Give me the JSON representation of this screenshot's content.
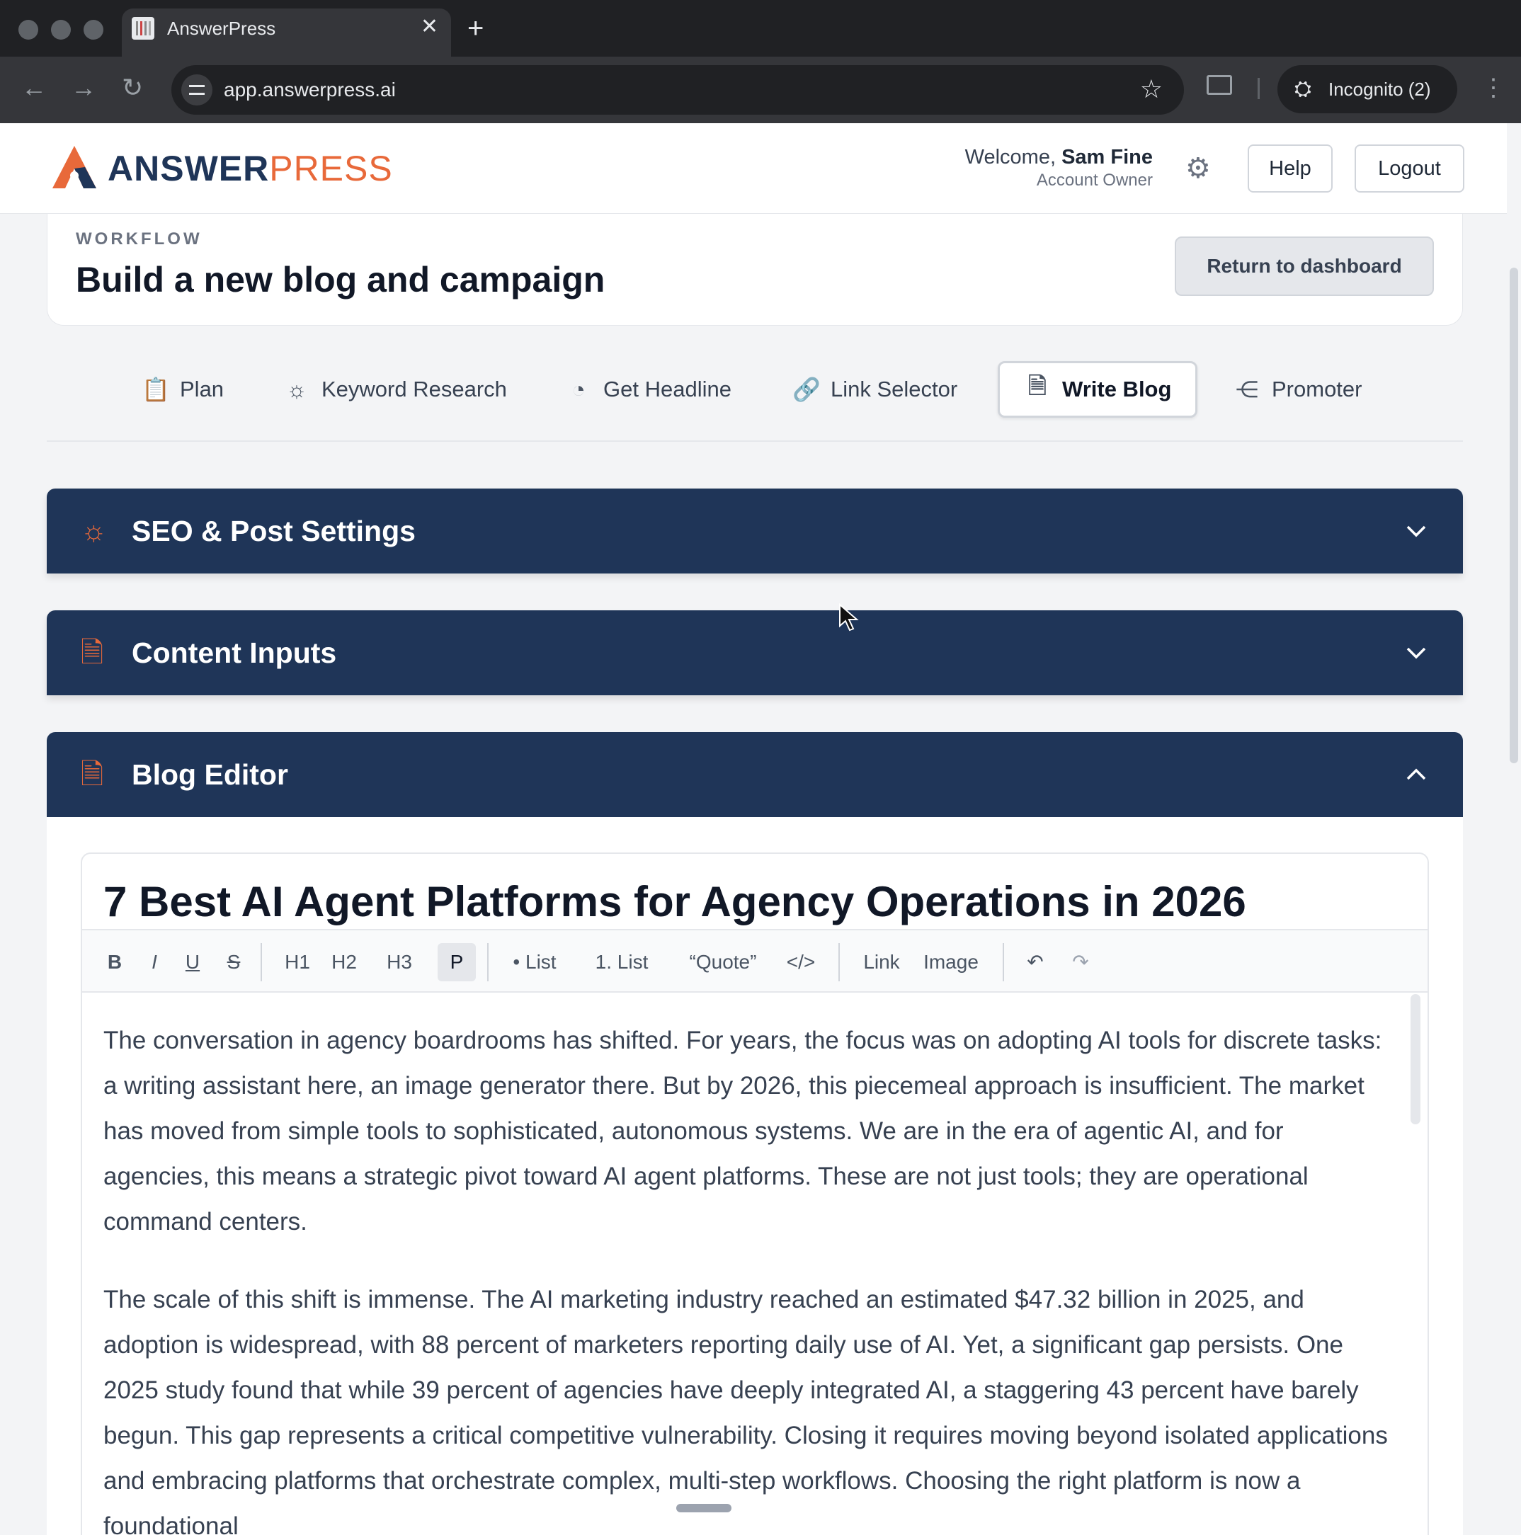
{
  "browser": {
    "tab_title": "AnswerPress",
    "tab_close": "✕",
    "new_tab": "+",
    "url": "app.answerpress.ai",
    "incognito_label": "Incognito (2)"
  },
  "header": {
    "logo_primary": "ANSWER",
    "logo_secondary": "PRESS",
    "welcome_prefix": "Welcome, ",
    "user_name": "Sam Fine",
    "user_role": "Account Owner",
    "help_label": "Help",
    "logout_label": "Logout"
  },
  "workflow": {
    "eyebrow": "WORKFLOW",
    "title": "Build a new blog and campaign",
    "return_label": "Return to dashboard"
  },
  "steps": [
    {
      "label": "Plan",
      "icon": "clipboard-icon"
    },
    {
      "label": "Keyword Research",
      "icon": "lightbulb-icon"
    },
    {
      "label": "Get Headline",
      "icon": "headline-icon"
    },
    {
      "label": "Link Selector",
      "icon": "link-icon"
    },
    {
      "label": "Write Blog",
      "icon": "document-icon",
      "active": true
    },
    {
      "label": "Promoter",
      "icon": "share-icon"
    }
  ],
  "sections": [
    {
      "title": "SEO & Post Settings",
      "icon": "lightbulb-icon",
      "state": "collapsed"
    },
    {
      "title": "Content Inputs",
      "icon": "document-icon",
      "state": "collapsed"
    },
    {
      "title": "Blog Editor",
      "icon": "document-icon",
      "state": "expanded"
    }
  ],
  "editor": {
    "title": "7 Best AI Agent Platforms for Agency Operations in 2026",
    "toolbar": {
      "bold": "B",
      "italic": "I",
      "underline": "U",
      "strike": "S",
      "h1": "H1",
      "h2": "H2",
      "h3": "H3",
      "p": "P",
      "bullet_list": "• List",
      "ordered_list": "1. List",
      "quote": "“Quote”",
      "code": "</>",
      "link": "Link",
      "image": "Image",
      "undo": "↶",
      "redo": "↷"
    },
    "paragraphs": [
      "The conversation in agency boardrooms has shifted. For years, the focus was on adopting AI tools for discrete tasks: a writing assistant here, an image generator there. But by 2026, this piecemeal approach is insufficient. The market has moved from simple tools to sophisticated, autonomous systems. We are in the era of agentic AI, and for agencies, this means a strategic pivot toward AI agent platforms. These are not just tools; they are operational command centers.",
      "The scale of this shift is immense. The AI marketing industry reached an estimated $47.32 billion in 2025, and adoption is widespread, with 88 percent of marketers reporting daily use of AI. Yet, a significant gap persists. One 2025 study found that while 39 percent of agencies have deeply integrated AI, a staggering 43 percent have barely begun. This gap represents a critical competitive vulnerability. Closing it requires moving beyond isolated applications and embracing platforms that orchestrate complex, multi-step workflows. Choosing the right platform is now a foundational"
    ]
  },
  "colors": {
    "brand_navy": "#1f3558",
    "brand_orange": "#e8693a"
  }
}
